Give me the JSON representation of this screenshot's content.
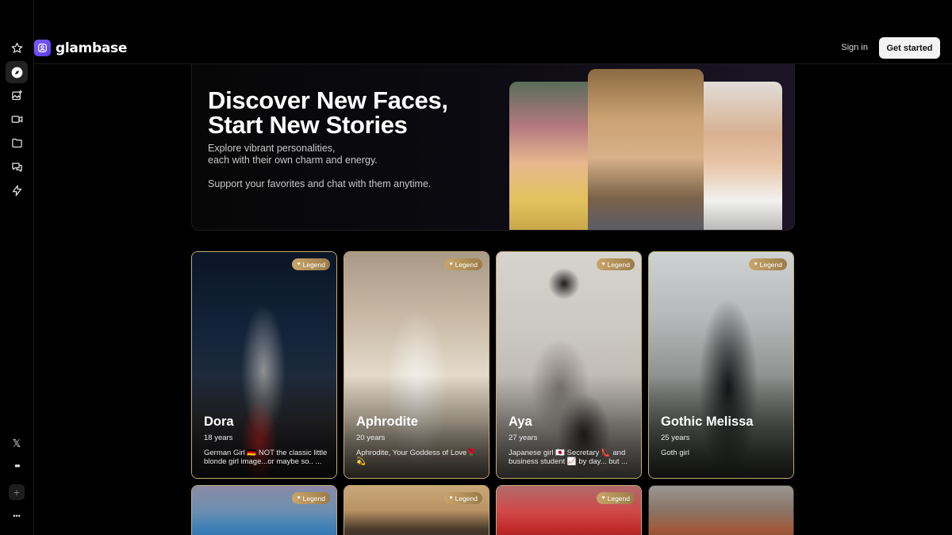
{
  "brand": {
    "name": "glambase",
    "accent": "#6b4cf5"
  },
  "header": {
    "signin_label": "Sign in",
    "getstarted_label": "Get started"
  },
  "sidebar": {
    "items": [
      {
        "icon": "star-icon"
      },
      {
        "icon": "compass-icon",
        "active": true
      },
      {
        "icon": "image-sparkle-icon"
      },
      {
        "icon": "video-icon"
      },
      {
        "icon": "folder-icon"
      },
      {
        "icon": "chat-icon"
      },
      {
        "icon": "lightning-icon"
      }
    ],
    "bottom": [
      {
        "icon": "x-logo-icon",
        "label": "𝕏"
      },
      {
        "icon": "medium-icon",
        "label": "●●"
      },
      {
        "icon": "plus-icon",
        "label": "+"
      },
      {
        "icon": "more-icon",
        "label": "•••"
      }
    ]
  },
  "hero": {
    "title_line1": "Discover New Faces,",
    "title_line2": "Start New Stories",
    "sub_line1": "Explore vibrant personalities,",
    "sub_line2": "each with their own charm and energy.",
    "sub_line3": "Support your favorites and chat with them anytime."
  },
  "badge_label": "Legend",
  "cards": [
    {
      "name": "Dora",
      "age": "18 years",
      "desc": "German Girl 🇩🇪 NOT the classic little blonde girl image...or maybe so.. ...",
      "badge": true
    },
    {
      "name": "Aphrodite",
      "age": "20 years",
      "desc": "Aphrodite, Your Goddess of Love🌹💫",
      "badge": true
    },
    {
      "name": "Aya",
      "age": "27 years",
      "desc": "Japanese girl 🇯🇵 Secretary 👠 and business student 📈 by day... but ...",
      "badge": true
    },
    {
      "name": "Gothic Melissa",
      "age": "25 years",
      "desc": "Goth girl",
      "badge": true
    }
  ],
  "cards_row2": [
    {
      "badge": true
    },
    {
      "badge": true
    },
    {
      "badge": true
    },
    {
      "badge": false
    }
  ]
}
